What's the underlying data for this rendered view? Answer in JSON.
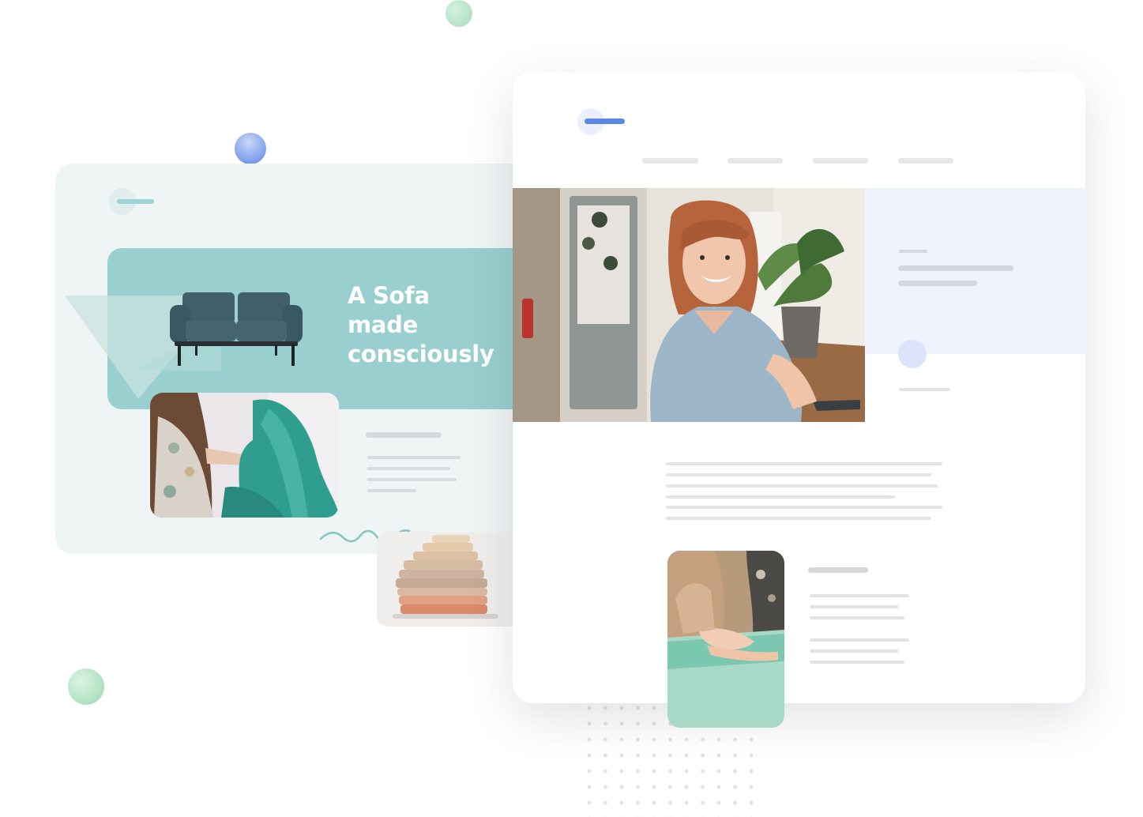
{
  "banner": {
    "headline_lines": [
      "A Sofa",
      "made",
      "consciously"
    ]
  },
  "images": {
    "sofa": "sofa-illustration",
    "fabric_person": "person-with-teal-fabric-photo",
    "folded_linens": "stack-of-folded-linens-photo",
    "smiling_woman": "smiling-woman-at-table-photo",
    "hands_fabric": "hands-on-teal-fabric-photo"
  },
  "colors": {
    "teal": "#99cfce",
    "teal_light": "#eff4f4",
    "blue_accent": "#5b86e5",
    "blue_panel": "#eff3fd",
    "green_dot": "#a4dcb8",
    "placeholder": "#e2e4e8"
  }
}
